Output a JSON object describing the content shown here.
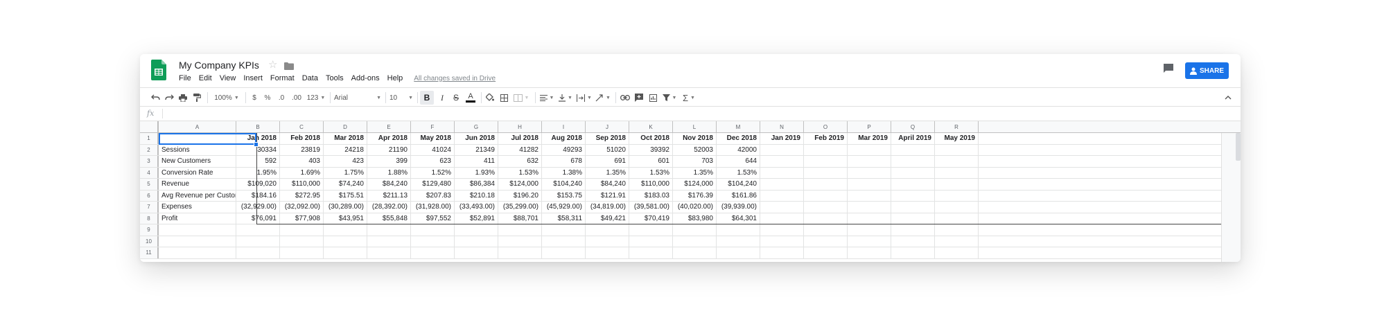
{
  "title": "My Company KPIs",
  "menu": [
    "File",
    "Edit",
    "View",
    "Insert",
    "Format",
    "Data",
    "Tools",
    "Add-ons",
    "Help"
  ],
  "save_status": "All changes saved in Drive",
  "share_label": "SHARE",
  "toolbar": {
    "zoom": "100%",
    "currency": "$",
    "percent": "%",
    "dec_decrease": ".0",
    "dec_increase": ".00",
    "more_formats": "123",
    "font": "Arial",
    "font_size": "10",
    "bold": "B",
    "italic": "I",
    "strike": "S",
    "text_color": "A"
  },
  "formula_icon": "fx",
  "columns": [
    "A",
    "B",
    "C",
    "D",
    "E",
    "F",
    "G",
    "H",
    "I",
    "J",
    "K",
    "L",
    "M",
    "N",
    "O",
    "P",
    "Q",
    "R"
  ],
  "column_widths": [
    112,
    63,
    63,
    63,
    63,
    63,
    63,
    63,
    63,
    63,
    63,
    63,
    63,
    63,
    63,
    63,
    63,
    63
  ],
  "rows": [
    [
      "",
      "Jan 2018",
      "Feb 2018",
      "Mar 2018",
      "Apr 2018",
      "May 2018",
      "Jun 2018",
      "Jul 2018",
      "Aug 2018",
      "Sep 2018",
      "Oct 2018",
      "Nov 2018",
      "Dec 2018",
      "Jan 2019",
      "Feb 2019",
      "Mar 2019",
      "April 2019",
      "May 2019"
    ],
    [
      "Sessions",
      "30334",
      "23819",
      "24218",
      "21190",
      "41024",
      "21349",
      "41282",
      "49293",
      "51020",
      "39392",
      "52003",
      "42000",
      "",
      "",
      "",
      "",
      ""
    ],
    [
      "New Customers",
      "592",
      "403",
      "423",
      "399",
      "623",
      "411",
      "632",
      "678",
      "691",
      "601",
      "703",
      "644",
      "",
      "",
      "",
      "",
      ""
    ],
    [
      "Conversion Rate",
      "1.95%",
      "1.69%",
      "1.75%",
      "1.88%",
      "1.52%",
      "1.93%",
      "1.53%",
      "1.38%",
      "1.35%",
      "1.53%",
      "1.35%",
      "1.53%",
      "",
      "",
      "",
      "",
      ""
    ],
    [
      "Revenue",
      "$109,020",
      "$110,000",
      "$74,240",
      "$84,240",
      "$129,480",
      "$86,384",
      "$124,000",
      "$104,240",
      "$84,240",
      "$110,000",
      "$124,000",
      "$104,240",
      "",
      "",
      "",
      "",
      ""
    ],
    [
      "Avg Revenue per Customer",
      "$184.16",
      "$272.95",
      "$175.51",
      "$211.13",
      "$207.83",
      "$210.18",
      "$196.20",
      "$153.75",
      "$121.91",
      "$183.03",
      "$176.39",
      "$161.86",
      "",
      "",
      "",
      "",
      ""
    ],
    [
      "Expenses",
      "(32,929.00)",
      "(32,092.00)",
      "(30,289.00)",
      "(28,392.00)",
      "(31,928.00)",
      "(33,493.00)",
      "(35,299.00)",
      "(45,929.00)",
      "(34,819.00)",
      "(39,581.00)",
      "(40,020.00)",
      "(39,939.00)",
      "",
      "",
      "",
      "",
      ""
    ],
    [
      "Profit",
      "$76,091",
      "$77,908",
      "$43,951",
      "$55,848",
      "$97,552",
      "$52,891",
      "$88,701",
      "$58,311",
      "$49,421",
      "$70,419",
      "$83,980",
      "$64,301",
      "",
      "",
      "",
      "",
      ""
    ],
    [
      "",
      "",
      "",
      "",
      "",
      "",
      "",
      "",
      "",
      "",
      "",
      "",
      "",
      "",
      "",
      "",
      "",
      ""
    ],
    [
      "",
      "",
      "",
      "",
      "",
      "",
      "",
      "",
      "",
      "",
      "",
      "",
      "",
      "",
      "",
      "",
      "",
      ""
    ],
    [
      "",
      "",
      "",
      "",
      "",
      "",
      "",
      "",
      "",
      "",
      "",
      "",
      "",
      "",
      "",
      "",
      "",
      ""
    ]
  ],
  "row_numbers": [
    "1",
    "2",
    "3",
    "4",
    "5",
    "6",
    "7",
    "8",
    "9",
    "10",
    "11"
  ]
}
